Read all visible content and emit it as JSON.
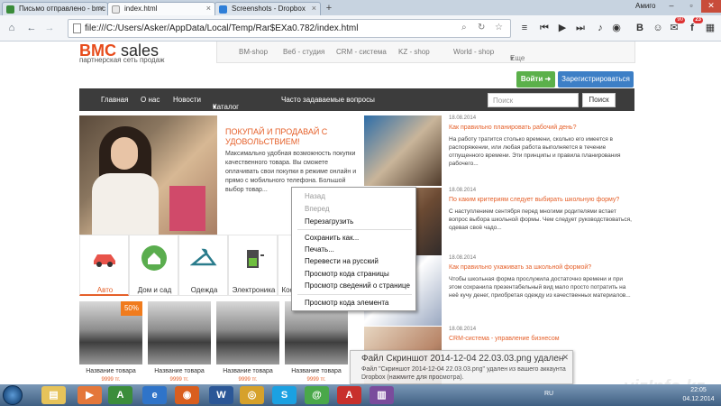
{
  "browser": {
    "tabs": [
      {
        "label": "Письмо отправлено - bmc"
      },
      {
        "label": "index.html"
      },
      {
        "label": "Screenshots - Dropbox"
      }
    ],
    "profile_name": "Амиго",
    "url": "file:///C:/Users/Asker/AppData/Local/Temp/Rar$EXa0.782/index.html",
    "extension_badges": {
      "mail": "90",
      "facebook": "23"
    }
  },
  "site": {
    "logo": {
      "brand": "BMC",
      "rest": " sales"
    },
    "tagline": "партнерская сеть продаж",
    "top_nav": [
      "BM-shop",
      "Веб - студия",
      "CRM - система",
      "KZ - shop",
      "World - shop",
      "Еще"
    ],
    "login_label": "Войти",
    "register_label": "Зарегистрироваться",
    "main_nav": [
      "Главная",
      "О нас",
      "Новости",
      "Каталог сайтов",
      "Часто задаваемые вопросы"
    ],
    "search": {
      "placeholder": "Поиск",
      "button": "Поиск"
    },
    "hero": {
      "title": "ПОКУПАЙ И ПРОДАВАЙ С УДОВОЛЬСТВИЕМ!",
      "text": "Максимально удобная возможность покупки качественного товара. Вы сможете оплачивать свои покупки в режиме онлайн и прямо с мобильного телефона. Большой выбор товар..."
    },
    "categories": [
      "Авто",
      "Дом и сад",
      "Одежда",
      "Электроника",
      "Кос"
    ],
    "products": [
      {
        "name": "Название товара",
        "price": "9999 тг.",
        "badge": "50%"
      },
      {
        "name": "Название товара",
        "price": "9999 тг.",
        "badge": ""
      },
      {
        "name": "Название товара",
        "price": "9999 тг.",
        "badge": ""
      },
      {
        "name": "Название товара",
        "price": "9999 тг.",
        "badge": ""
      }
    ],
    "news": [
      {
        "date": "18.08.2014",
        "title": "Как правильно планировать рабочий день?",
        "text": "На работу тратится столько времени, сколько его имеется в распоряжении, или любая работа выполняется в течение отпущенного времени. Эти принципы и правила планирования рабочего..."
      },
      {
        "date": "18.08.2014",
        "title": "По каким критериям следует выбирать школьную форму?",
        "text": "С наступлением сентября перед многими родителями встает вопрос выбора школьной формы. Чем следует руководствоваться, одевая своё чадо..."
      },
      {
        "date": "18.08.2014",
        "title": "Как правильно ухаживать за школьной формой?",
        "text": "Чтобы школьная форма прослужила достаточно времени и при этом сохранила презентабельный вид мало просто потратить на неё кучу денег, приобретая одежду из качественных материалов..."
      },
      {
        "date": "18.08.2014",
        "title": "CRM-система - управление бизнесом",
        "text": ""
      }
    ]
  },
  "context_menu": {
    "back": "Назад",
    "forward": "Вперед",
    "reload": "Перезагрузить",
    "save_as": "Сохранить как...",
    "print": "Печать...",
    "translate": "Перевести на русский",
    "view_source": "Просмотр кода страницы",
    "page_info": "Просмотр  сведений о странице",
    "inspect": "Просмотр кода элемента"
  },
  "notification": {
    "title": "Файл Скриншот 2014-12-04 22.03.03.png удален",
    "body": "Файл \"Скриншот 2014-12-04 22.03.03.png\" удален из вашего аккаунта Dropbox (нажмите для просмотра)."
  },
  "taskbar": {
    "lang": "RU",
    "time": "22:05",
    "date": "04.12.2014"
  },
  "watermark": "vizInfo.kz",
  "colors": {
    "accent": "#e5602a",
    "nav": "#3c3c3c",
    "login": "#5bb04a",
    "register": "#3d7fc6"
  }
}
